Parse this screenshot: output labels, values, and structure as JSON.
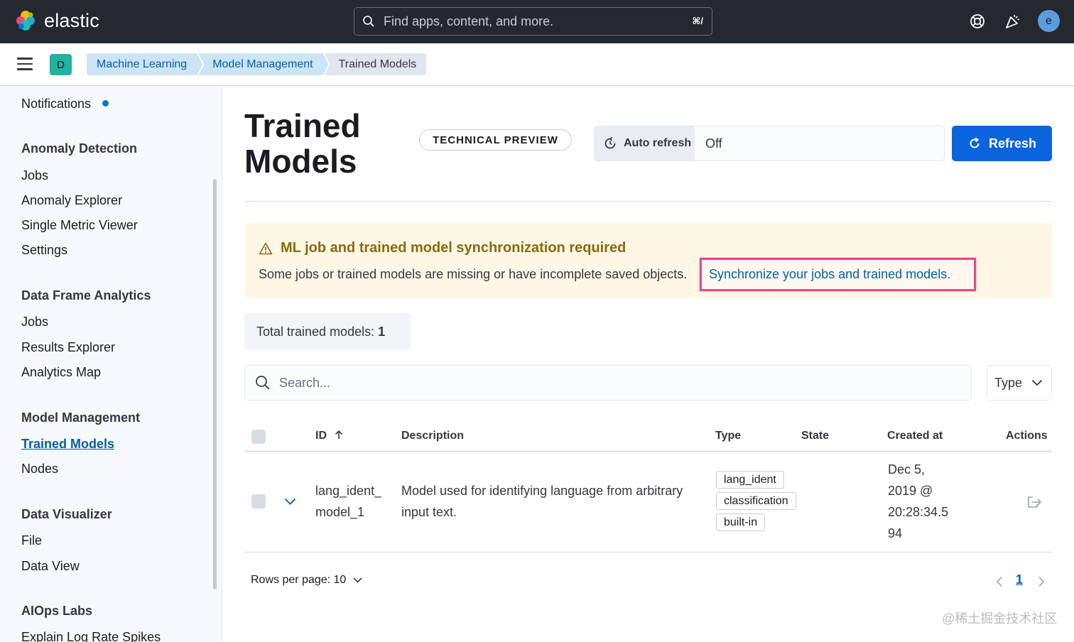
{
  "app": {
    "brand": "elastic",
    "search_placeholder": "Find apps, content, and more.",
    "search_shortcut": "⌘/",
    "user_initial": "e",
    "space_initial": "D"
  },
  "breadcrumbs": [
    "Machine Learning",
    "Model Management",
    "Trained Models"
  ],
  "sidebar": {
    "notifications": "Notifications",
    "sections": [
      {
        "title": "Anomaly Detection",
        "items": [
          "Jobs",
          "Anomaly Explorer",
          "Single Metric Viewer",
          "Settings"
        ]
      },
      {
        "title": "Data Frame Analytics",
        "items": [
          "Jobs",
          "Results Explorer",
          "Analytics Map"
        ]
      },
      {
        "title": "Model Management",
        "items": [
          "Trained Models",
          "Nodes"
        ]
      },
      {
        "title": "Data Visualizer",
        "items": [
          "File",
          "Data View"
        ]
      },
      {
        "title": "AIOps Labs",
        "items": [
          "Explain Log Rate Spikes"
        ]
      }
    ]
  },
  "page": {
    "title_line1": "Trained",
    "title_line2": "Models",
    "badge": "TECHNICAL PREVIEW",
    "auto_refresh_label": "Auto refresh",
    "auto_refresh_value": "Off",
    "refresh_button": "Refresh"
  },
  "callout": {
    "title": "ML job and trained model synchronization required",
    "text": "Some jobs or trained models are missing or have incomplete saved objects.",
    "link": "Synchronize your jobs and trained models."
  },
  "summary": {
    "label": "Total trained models:",
    "count": "1"
  },
  "table": {
    "search_placeholder": "Search...",
    "type_filter": "Type",
    "columns": [
      "ID",
      "Description",
      "Type",
      "State",
      "Created at",
      "Actions"
    ],
    "rows": [
      {
        "id_line1": "lang_ident_",
        "id_line2": "model_1",
        "description_line1": "Model used for identifying language from arbitrary",
        "description_line2": "input text.",
        "types": [
          "lang_ident",
          "classification",
          "built-in"
        ],
        "state": "",
        "created_line1": "Dec 5,",
        "created_line2": "2019 @",
        "created_line3": "20:28:34.5",
        "created_line4": "94"
      }
    ],
    "rows_per_page": "Rows per page: 10",
    "current_page": "1"
  },
  "watermark": "@稀土掘金技术社区",
  "colors": {
    "primary": "#0b64dd",
    "link": "#0061a6",
    "warning_bg": "#fef7e6",
    "warning_text": "#8a6a0a",
    "highlight": "#e8488a",
    "header_bg": "#25282f"
  }
}
